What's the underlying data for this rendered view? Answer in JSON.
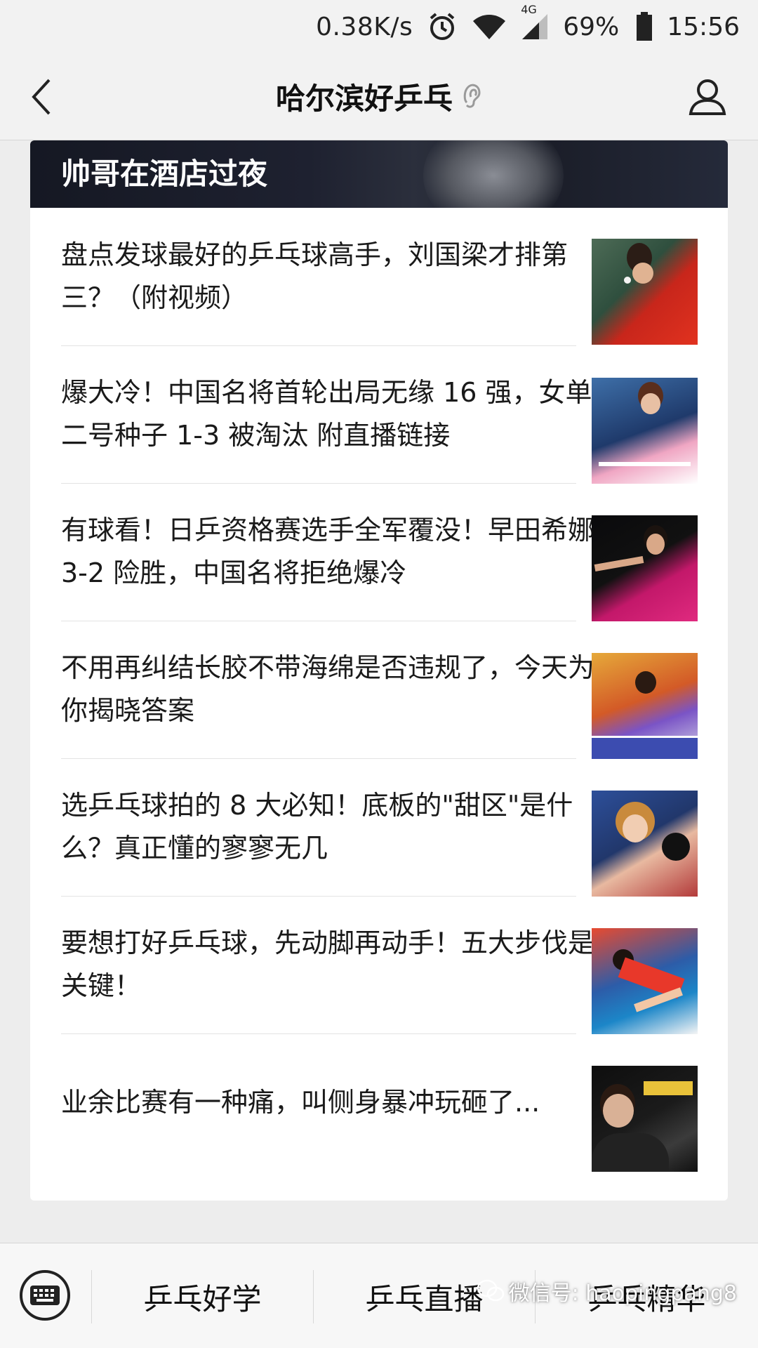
{
  "status_bar": {
    "net_speed": "0.38K/s",
    "network_type": "4G",
    "battery": "69%",
    "time": "15:56",
    "icons": [
      "alarm-icon",
      "wifi-icon",
      "cellular-signal-icon",
      "battery-icon"
    ]
  },
  "nav": {
    "title": "哈尔滨好乒乓",
    "icons": [
      "back-arrow-icon",
      "ear-icon",
      "profile-icon"
    ]
  },
  "banner": {
    "title": "帅哥在酒店过夜"
  },
  "articles": [
    {
      "title": "盘点发球最好的乒乓球高手，刘国梁才排第三？（附视频）"
    },
    {
      "title": "爆大冷！中国名将首轮出局无缘 16 强，女单二号种子 1-3 被淘汰 附直播链接"
    },
    {
      "title": "有球看！日乒资格赛选手全军覆没！早田希娜 3-2 险胜，中国名将拒绝爆冷"
    },
    {
      "title": "不用再纠结长胶不带海绵是否违规了，今天为你揭晓答案"
    },
    {
      "title": "选乒乓球拍的 8 大必知！底板的\"甜区\"是什么？真正懂的寥寥无几"
    },
    {
      "title": "要想打好乒乓球，先动脚再动手！五大步伐是关键！"
    },
    {
      "title": "业余比赛有一种痛，叫侧身暴冲玩砸了..."
    }
  ],
  "bottom_menu": {
    "items": [
      "乒乓好学",
      "乒乓直播",
      "乒乓精华"
    ],
    "watermark": "微信号: haopingpang8"
  }
}
